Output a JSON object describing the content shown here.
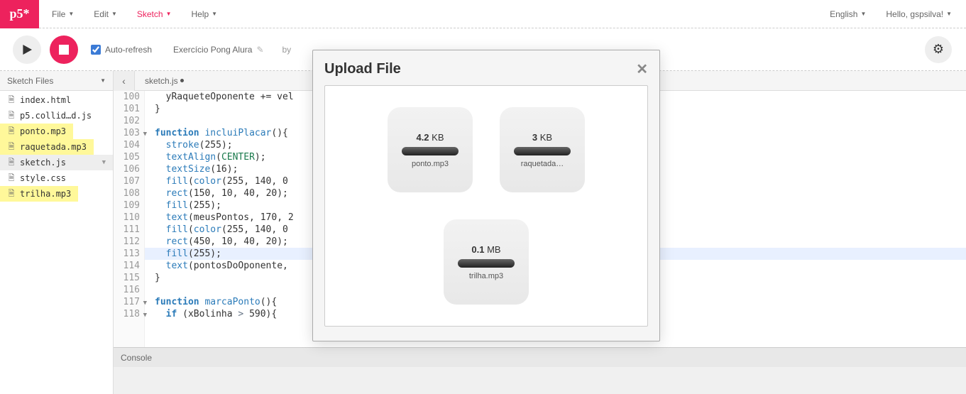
{
  "logo": "p5*",
  "menu": {
    "file": "File",
    "edit": "Edit",
    "sketch": "Sketch",
    "help": "Help"
  },
  "menuRight": {
    "language": "English",
    "greeting": "Hello, gspsilva!"
  },
  "toolbar": {
    "autoRefresh": "Auto-refresh",
    "sketchName": "Exercício Pong Alura",
    "by": "by"
  },
  "sidebar": {
    "header": "Sketch Files",
    "files": [
      {
        "name": "index.html",
        "highlight": false,
        "selected": false
      },
      {
        "name": "p5.collid…d.js",
        "highlight": false,
        "selected": false
      },
      {
        "name": "ponto.mp3",
        "highlight": true,
        "selected": false
      },
      {
        "name": "raquetada.mp3",
        "highlight": true,
        "selected": false
      },
      {
        "name": "sketch.js",
        "highlight": false,
        "selected": true
      },
      {
        "name": "style.css",
        "highlight": false,
        "selected": false
      },
      {
        "name": "trilha.mp3",
        "highlight": true,
        "selected": false
      }
    ]
  },
  "editor": {
    "tab": "sketch.js",
    "activeLine": 113,
    "lines": [
      {
        "n": 100,
        "html": "  yRaqueteOponente += vel"
      },
      {
        "n": 101,
        "html": "}"
      },
      {
        "n": 102,
        "html": ""
      },
      {
        "n": 103,
        "html": "<span class='kw'>function</span> <span class='fn'>incluiPlacar</span>(){",
        "fold": true
      },
      {
        "n": 104,
        "html": "  <span class='fn'>stroke</span>(<span class='num'>255</span>);"
      },
      {
        "n": 105,
        "html": "  <span class='fn'>textAlign</span>(<span class='const'>CENTER</span>);"
      },
      {
        "n": 106,
        "html": "  <span class='fn'>textSize</span>(<span class='num'>16</span>);"
      },
      {
        "n": 107,
        "html": "  <span class='fn'>fill</span>(<span class='fn'>color</span>(<span class='num'>255</span>, <span class='num'>140</span>, <span class='num'>0</span>"
      },
      {
        "n": 108,
        "html": "  <span class='fn'>rect</span>(<span class='num'>150</span>, <span class='num'>10</span>, <span class='num'>40</span>, <span class='num'>20</span>);"
      },
      {
        "n": 109,
        "html": "  <span class='fn'>fill</span>(<span class='num'>255</span>);"
      },
      {
        "n": 110,
        "html": "  <span class='fn'>text</span>(meusPontos, <span class='num'>170</span>, <span class='num'>2</span>"
      },
      {
        "n": 111,
        "html": "  <span class='fn'>fill</span>(<span class='fn'>color</span>(<span class='num'>255</span>, <span class='num'>140</span>, <span class='num'>0</span>"
      },
      {
        "n": 112,
        "html": "  <span class='fn'>rect</span>(<span class='num'>450</span>, <span class='num'>10</span>, <span class='num'>40</span>, <span class='num'>20</span>);"
      },
      {
        "n": 113,
        "html": "  <span class='fn'>fill</span>(<span class='num'>255</span>);"
      },
      {
        "n": 114,
        "html": "  <span class='fn'>text</span>(pontosDoOponente,"
      },
      {
        "n": 115,
        "html": "}"
      },
      {
        "n": 116,
        "html": ""
      },
      {
        "n": 117,
        "html": "<span class='kw'>function</span> <span class='fn'>marcaPonto</span>(){",
        "fold": true
      },
      {
        "n": 118,
        "html": "  <span class='kw'>if</span> (xBolinha <span class='op'>&gt;</span> <span class='num'>590</span>){",
        "fold": true
      }
    ]
  },
  "console": {
    "label": "Console"
  },
  "modal": {
    "title": "Upload File",
    "files": [
      {
        "sizeNum": "4.2",
        "sizeUnit": "KB",
        "name": "ponto.mp3"
      },
      {
        "sizeNum": "3",
        "sizeUnit": "KB",
        "name": "raquetada…"
      },
      {
        "sizeNum": "0.1",
        "sizeUnit": "MB",
        "name": "trilha.mp3"
      }
    ]
  }
}
